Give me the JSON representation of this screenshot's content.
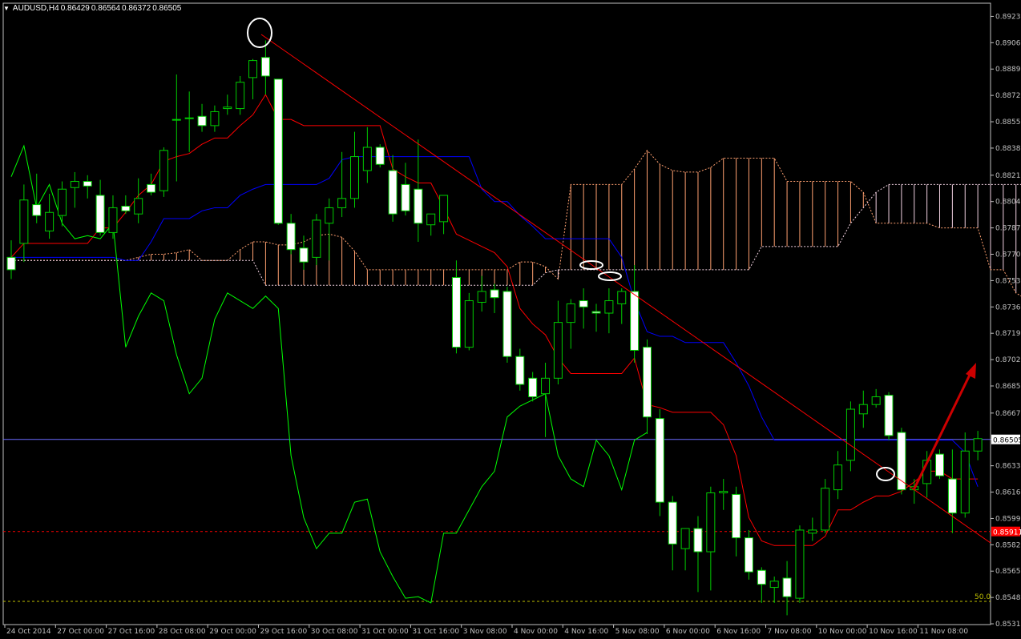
{
  "header": {
    "symbol": "AUDUSD,H4",
    "open": "0.86429",
    "high": "0.86564",
    "low": "0.86372",
    "close": "0.86505",
    "menu_icon": "triangle-down-icon"
  },
  "colors": {
    "background": "#000000",
    "axis": "#c0c0c0",
    "bull": "#00cc00",
    "bear": "#ffffff",
    "tenkan": "#ff0000",
    "kijun": "#0000ff",
    "chikou": "#00ff00",
    "cloud_up": "#ffa070",
    "cloud_down": "#f0d0e0",
    "trendline": "#ff0000",
    "bid_line": "#6a6aff",
    "level_red": "#ff0000",
    "level_50": "#c0c000",
    "arrow": "#cc0000",
    "markers": "#ffffff"
  },
  "chart_data": {
    "type": "candlestick",
    "symbol": "AUDUSD",
    "timeframe": "H4",
    "ylim": [
      0.8531,
      0.8932
    ],
    "y_ticks": [
      "0.89235",
      "0.89065",
      "0.88895",
      "0.88725",
      "0.88555",
      "0.88385",
      "0.88210",
      "0.88040",
      "0.87870",
      "0.87700",
      "0.87530",
      "0.87360",
      "0.87190",
      "0.87020",
      "0.86850",
      "0.86675",
      "0.86505",
      "0.86335",
      "0.86165",
      "0.85995",
      "0.85825",
      "0.85655",
      "0.85485",
      "0.85315"
    ],
    "x_ticks": [
      "24 Oct 2014",
      "27 Oct 00:00",
      "27 Oct 16:00",
      "28 Oct 08:00",
      "29 Oct 00:00",
      "29 Oct 16:00",
      "30 Oct 08:00",
      "31 Oct 00:00",
      "31 Oct 16:00",
      "3 Nov 08:00",
      "4 Nov 00:00",
      "4 Nov 16:00",
      "5 Nov 08:00",
      "6 Nov 00:00",
      "6 Nov 16:00",
      "7 Nov 08:00",
      "10 Nov 00:00",
      "10 Nov 16:00",
      "11 Nov 08:00"
    ],
    "bid_price": "0.86505",
    "red_level_price": "0.85911",
    "fib_label": "50.0",
    "fib_price": 0.8546,
    "candles": [
      {
        "o": 0.8768,
        "h": 0.8779,
        "l": 0.8754,
        "c": 0.876
      },
      {
        "o": 0.8777,
        "h": 0.8815,
        "l": 0.8765,
        "c": 0.8805
      },
      {
        "o": 0.8802,
        "h": 0.8822,
        "l": 0.879,
        "c": 0.8795
      },
      {
        "o": 0.8785,
        "h": 0.8809,
        "l": 0.878,
        "c": 0.8797
      },
      {
        "o": 0.8795,
        "h": 0.8817,
        "l": 0.8788,
        "c": 0.8812
      },
      {
        "o": 0.8813,
        "h": 0.8823,
        "l": 0.88,
        "c": 0.8817
      },
      {
        "o": 0.8817,
        "h": 0.8821,
        "l": 0.8806,
        "c": 0.8814
      },
      {
        "o": 0.8808,
        "h": 0.8818,
        "l": 0.8782,
        "c": 0.8784
      },
      {
        "o": 0.8784,
        "h": 0.8808,
        "l": 0.878,
        "c": 0.88
      },
      {
        "o": 0.8801,
        "h": 0.8808,
        "l": 0.8796,
        "c": 0.8798
      },
      {
        "o": 0.8796,
        "h": 0.8819,
        "l": 0.879,
        "c": 0.8806
      },
      {
        "o": 0.8815,
        "h": 0.8822,
        "l": 0.8808,
        "c": 0.881
      },
      {
        "o": 0.8811,
        "h": 0.8839,
        "l": 0.8807,
        "c": 0.8837
      },
      {
        "o": 0.8857,
        "h": 0.8886,
        "l": 0.8817,
        "c": 0.8857
      },
      {
        "o": 0.8858,
        "h": 0.8875,
        "l": 0.8836,
        "c": 0.8858
      },
      {
        "o": 0.8859,
        "h": 0.8867,
        "l": 0.8849,
        "c": 0.8853
      },
      {
        "o": 0.8853,
        "h": 0.8866,
        "l": 0.8849,
        "c": 0.8862
      },
      {
        "o": 0.8864,
        "h": 0.8873,
        "l": 0.886,
        "c": 0.8865
      },
      {
        "o": 0.8864,
        "h": 0.8885,
        "l": 0.886,
        "c": 0.8881
      },
      {
        "o": 0.8884,
        "h": 0.8896,
        "l": 0.887,
        "c": 0.8895
      },
      {
        "o": 0.8897,
        "h": 0.8908,
        "l": 0.8873,
        "c": 0.8885
      },
      {
        "o": 0.8883,
        "h": 0.8883,
        "l": 0.8789,
        "c": 0.879
      },
      {
        "o": 0.879,
        "h": 0.8796,
        "l": 0.877,
        "c": 0.8773
      },
      {
        "o": 0.8774,
        "h": 0.8782,
        "l": 0.876,
        "c": 0.8765
      },
      {
        "o": 0.8768,
        "h": 0.8796,
        "l": 0.8763,
        "c": 0.8792
      },
      {
        "o": 0.879,
        "h": 0.8806,
        "l": 0.8766,
        "c": 0.88
      },
      {
        "o": 0.88,
        "h": 0.8836,
        "l": 0.8794,
        "c": 0.8806
      },
      {
        "o": 0.8806,
        "h": 0.8849,
        "l": 0.88,
        "c": 0.8833
      },
      {
        "o": 0.8824,
        "h": 0.8852,
        "l": 0.8816,
        "c": 0.8839
      },
      {
        "o": 0.8839,
        "h": 0.8841,
        "l": 0.8826,
        "c": 0.8828
      },
      {
        "o": 0.8824,
        "h": 0.8834,
        "l": 0.8791,
        "c": 0.8796
      },
      {
        "o": 0.8815,
        "h": 0.8829,
        "l": 0.8795,
        "c": 0.8798
      },
      {
        "o": 0.8812,
        "h": 0.8844,
        "l": 0.8778,
        "c": 0.879
      },
      {
        "o": 0.8789,
        "h": 0.8796,
        "l": 0.8782,
        "c": 0.8796
      },
      {
        "o": 0.8791,
        "h": 0.8808,
        "l": 0.8783,
        "c": 0.8808
      },
      {
        "o": 0.8755,
        "h": 0.8766,
        "l": 0.8706,
        "c": 0.871
      },
      {
        "o": 0.871,
        "h": 0.8745,
        "l": 0.8708,
        "c": 0.874
      },
      {
        "o": 0.8739,
        "h": 0.8756,
        "l": 0.8733,
        "c": 0.8746
      },
      {
        "o": 0.8747,
        "h": 0.8751,
        "l": 0.8732,
        "c": 0.8742
      },
      {
        "o": 0.8746,
        "h": 0.8749,
        "l": 0.87,
        "c": 0.8704
      },
      {
        "o": 0.8704,
        "h": 0.8709,
        "l": 0.8682,
        "c": 0.8686
      },
      {
        "o": 0.869,
        "h": 0.8694,
        "l": 0.8675,
        "c": 0.8678
      },
      {
        "o": 0.868,
        "h": 0.87,
        "l": 0.8652,
        "c": 0.869
      },
      {
        "o": 0.869,
        "h": 0.874,
        "l": 0.8686,
        "c": 0.8726
      },
      {
        "o": 0.8726,
        "h": 0.8741,
        "l": 0.8709,
        "c": 0.8738
      },
      {
        "o": 0.874,
        "h": 0.8748,
        "l": 0.8722,
        "c": 0.8736
      },
      {
        "o": 0.8733,
        "h": 0.8738,
        "l": 0.872,
        "c": 0.8732
      },
      {
        "o": 0.8732,
        "h": 0.8748,
        "l": 0.8719,
        "c": 0.874
      },
      {
        "o": 0.8738,
        "h": 0.8748,
        "l": 0.8725,
        "c": 0.8746
      },
      {
        "o": 0.8746,
        "h": 0.8763,
        "l": 0.87,
        "c": 0.8708
      },
      {
        "o": 0.871,
        "h": 0.8715,
        "l": 0.8654,
        "c": 0.8665
      },
      {
        "o": 0.8664,
        "h": 0.867,
        "l": 0.8601,
        "c": 0.861
      },
      {
        "o": 0.861,
        "h": 0.8614,
        "l": 0.8566,
        "c": 0.8583
      },
      {
        "o": 0.858,
        "h": 0.8592,
        "l": 0.8566,
        "c": 0.8593
      },
      {
        "o": 0.8593,
        "h": 0.8601,
        "l": 0.8552,
        "c": 0.8578
      },
      {
        "o": 0.8578,
        "h": 0.862,
        "l": 0.8553,
        "c": 0.8616
      },
      {
        "o": 0.8616,
        "h": 0.8625,
        "l": 0.8605,
        "c": 0.8617
      },
      {
        "o": 0.8615,
        "h": 0.862,
        "l": 0.8575,
        "c": 0.8587
      },
      {
        "o": 0.8587,
        "h": 0.8592,
        "l": 0.856,
        "c": 0.8565
      },
      {
        "o": 0.8566,
        "h": 0.8568,
        "l": 0.8545,
        "c": 0.8557
      },
      {
        "o": 0.8555,
        "h": 0.8562,
        "l": 0.8545,
        "c": 0.8559
      },
      {
        "o": 0.8561,
        "h": 0.8572,
        "l": 0.8537,
        "c": 0.8549
      },
      {
        "o": 0.8548,
        "h": 0.8595,
        "l": 0.8545,
        "c": 0.8592
      },
      {
        "o": 0.859,
        "h": 0.86,
        "l": 0.8585,
        "c": 0.8592
      },
      {
        "o": 0.8592,
        "h": 0.8625,
        "l": 0.859,
        "c": 0.8619
      },
      {
        "o": 0.8618,
        "h": 0.8643,
        "l": 0.8612,
        "c": 0.8634
      },
      {
        "o": 0.8637,
        "h": 0.8675,
        "l": 0.863,
        "c": 0.867
      },
      {
        "o": 0.8667,
        "h": 0.8682,
        "l": 0.8658,
        "c": 0.8673
      },
      {
        "o": 0.8673,
        "h": 0.8683,
        "l": 0.8671,
        "c": 0.8678
      },
      {
        "o": 0.8679,
        "h": 0.8681,
        "l": 0.865,
        "c": 0.8653
      },
      {
        "o": 0.8655,
        "h": 0.8658,
        "l": 0.8615,
        "c": 0.8618
      },
      {
        "o": 0.8618,
        "h": 0.8625,
        "l": 0.8609,
        "c": 0.862
      },
      {
        "o": 0.8622,
        "h": 0.8643,
        "l": 0.8613,
        "c": 0.8637
      },
      {
        "o": 0.8641,
        "h": 0.8644,
        "l": 0.8625,
        "c": 0.8627
      },
      {
        "o": 0.8625,
        "h": 0.8644,
        "l": 0.859,
        "c": 0.8603
      },
      {
        "o": 0.8603,
        "h": 0.8655,
        "l": 0.86,
        "c": 0.8643
      },
      {
        "o": 0.8643,
        "h": 0.8656,
        "l": 0.8637,
        "c": 0.8651
      }
    ],
    "series": [
      {
        "name": "",
        "values": [
          0.8768,
          0.8777,
          0.8777,
          0.8777,
          0.8777,
          0.8777,
          0.8777,
          0.8787,
          0.8787,
          0.8797,
          0.8808,
          0.8815,
          0.883,
          0.8833,
          0.8835,
          0.8841,
          0.8845,
          0.8845,
          0.8853,
          0.886,
          0.8873,
          0.8857,
          0.8857,
          0.8853,
          0.8853,
          0.8853,
          0.8853,
          0.8853,
          0.8853,
          0.8853,
          0.8825,
          0.882,
          0.8816,
          0.8816,
          0.88,
          0.8783,
          0.8779,
          0.8775,
          0.8771,
          0.8762,
          0.8735,
          0.8725,
          0.8718,
          0.8703,
          0.8693,
          0.8693,
          0.8693,
          0.8693,
          0.8693,
          0.8703,
          0.8673,
          0.8671,
          0.8668,
          0.8668,
          0.8668,
          0.8668,
          0.866,
          0.864,
          0.86,
          0.8585,
          0.8582,
          0.8582,
          0.8582,
          0.8582,
          0.8588,
          0.8605,
          0.8605,
          0.861,
          0.8614,
          0.8614,
          0.8617,
          0.8623,
          0.863,
          0.863,
          0.8625,
          0.8625,
          0.8625
        ]
      },
      {
        "name": "",
        "values": [
          0.8768,
          0.8768,
          0.8768,
          0.8768,
          0.8768,
          0.8768,
          0.8768,
          0.8768,
          0.8768,
          0.8766,
          0.8766,
          0.8778,
          0.8793,
          0.8793,
          0.8793,
          0.8798,
          0.88,
          0.88,
          0.8808,
          0.8812,
          0.8815,
          0.8815,
          0.8815,
          0.8815,
          0.8815,
          0.8819,
          0.8831,
          0.8833,
          0.8833,
          0.8833,
          0.8833,
          0.8833,
          0.8833,
          0.8833,
          0.8833,
          0.8833,
          0.8833,
          0.8812,
          0.8804,
          0.8804,
          0.8795,
          0.8788,
          0.878,
          0.878,
          0.878,
          0.878,
          0.878,
          0.878,
          0.8768,
          0.874,
          0.872,
          0.8717,
          0.8717,
          0.8713,
          0.8713,
          0.8713,
          0.8713,
          0.87,
          0.8685,
          0.8665,
          0.865,
          0.865,
          0.865,
          0.865,
          0.865,
          0.865,
          0.865,
          0.865,
          0.865,
          0.865,
          0.865,
          0.865,
          0.865,
          0.865,
          0.865,
          0.8642,
          0.862
        ]
      },
      {
        "name": "",
        "values": [
          0.882,
          0.884,
          0.88,
          0.8815,
          0.879,
          0.878,
          0.8782,
          0.878,
          0.879,
          0.871,
          0.873,
          0.8745,
          0.874,
          0.8705,
          0.868,
          0.869,
          0.8728,
          0.8745,
          0.874,
          0.8735,
          0.8743,
          0.8735,
          0.864,
          0.86,
          0.858,
          0.859,
          0.859,
          0.861,
          0.8612,
          0.8578,
          0.8562,
          0.8548,
          0.8549,
          0.8545,
          0.859,
          0.859,
          0.8605,
          0.862,
          0.863,
          0.8665,
          0.8672,
          0.8676,
          0.868,
          0.864,
          0.8625,
          0.862,
          0.865,
          0.864,
          0.8618,
          0.865,
          0.8655
        ]
      }
    ],
    "cloud": {
      "span_a": [
        0.8766,
        0.8766,
        0.8766,
        0.8766,
        0.8766,
        0.8766,
        0.8766,
        0.8766,
        0.8766,
        0.8766,
        0.8768,
        0.877,
        0.877,
        0.8771,
        0.8773,
        0.8766,
        0.8766,
        0.8766,
        0.8773,
        0.8778,
        0.8778,
        0.8776,
        0.8776,
        0.8778,
        0.8782,
        0.8783,
        0.8781,
        0.8772,
        0.876,
        0.876,
        0.876,
        0.876,
        0.876,
        0.876,
        0.876,
        0.876,
        0.876,
        0.876,
        0.876,
        0.876,
        0.8765,
        0.8765,
        0.8762,
        0.8754,
        0.8815,
        0.8815,
        0.8815,
        0.8815,
        0.8815,
        0.8825,
        0.8837,
        0.8828,
        0.8824,
        0.8823,
        0.8823,
        0.8826,
        0.8832,
        0.8832,
        0.8832,
        0.8832,
        0.8832,
        0.8817,
        0.8817,
        0.8817,
        0.8817,
        0.8817,
        0.8817,
        0.881,
        0.879,
        0.879,
        0.879,
        0.879,
        0.879,
        0.8787,
        0.8787,
        0.8787,
        0.8787,
        0.876,
        0.876,
        0.8745,
        0.874,
        0.874,
        0.874,
        0.874,
        0.874,
        0.874,
        0.874,
        0.8725,
        0.871,
        0.87
      ],
      "span_b": [
        0.8766,
        0.8766,
        0.8766,
        0.8766,
        0.8766,
        0.8766,
        0.8766,
        0.8766,
        0.8766,
        0.8766,
        0.8766,
        0.8766,
        0.8766,
        0.8766,
        0.8766,
        0.8766,
        0.8766,
        0.8766,
        0.8766,
        0.8766,
        0.875,
        0.875,
        0.875,
        0.875,
        0.875,
        0.875,
        0.875,
        0.875,
        0.875,
        0.875,
        0.875,
        0.875,
        0.875,
        0.875,
        0.875,
        0.875,
        0.875,
        0.875,
        0.875,
        0.875,
        0.875,
        0.875,
        0.8758,
        0.876,
        0.876,
        0.876,
        0.876,
        0.876,
        0.876,
        0.876,
        0.876,
        0.876,
        0.876,
        0.876,
        0.876,
        0.876,
        0.876,
        0.876,
        0.876,
        0.8775,
        0.8775,
        0.8775,
        0.8775,
        0.8775,
        0.8775,
        0.8775,
        0.879,
        0.88,
        0.881,
        0.8815,
        0.8815,
        0.8815,
        0.8815,
        0.8815,
        0.8815,
        0.8815,
        0.8815,
        0.8815,
        0.8815,
        0.8815,
        0.8815,
        0.8815,
        0.8815,
        0.8815,
        0.8815,
        0.8815,
        0.8815,
        0.8815,
        0.8815,
        0.8815
      ]
    }
  }
}
